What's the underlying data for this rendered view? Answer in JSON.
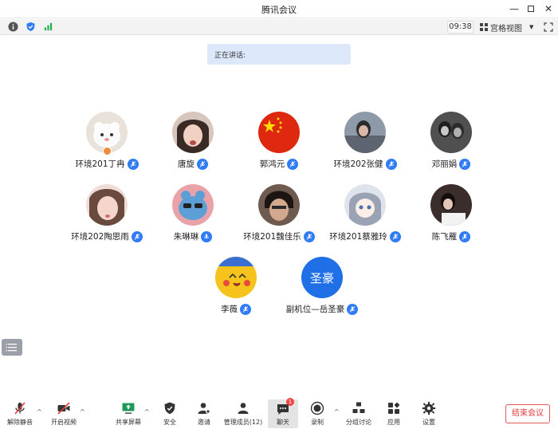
{
  "window": {
    "title": "腾讯会议"
  },
  "infobar": {
    "time": "09:38",
    "view_label": "宫格视图"
  },
  "speaking": {
    "label": "正在讲话:"
  },
  "participants": [
    {
      "name": "环境201丁冉",
      "avatar_color": "#d9d3cc"
    },
    {
      "name": "唐旋",
      "avatar_color": "#c9a99a"
    },
    {
      "name": "郭鸿元",
      "avatar_color": "#de2910"
    },
    {
      "name": "环境202张健",
      "avatar_color": "#7a8797"
    },
    {
      "name": "邓丽娟",
      "avatar_color": "#4a4a4a"
    },
    {
      "name": "环境202陶思雨",
      "avatar_color": "#e8c9c2"
    },
    {
      "name": "朱琳琳",
      "avatar_color": "#5c9fd6"
    },
    {
      "name": "环境201魏佳乐",
      "avatar_color": "#3b2f2a"
    },
    {
      "name": "环境201蔡雅玲",
      "avatar_color": "#b9bfcc"
    },
    {
      "name": "陈飞雁",
      "avatar_color": "#2a2222"
    },
    {
      "name": "李薇",
      "avatar_color": "#f5c31c"
    },
    {
      "name": "副机位—岳圣豪",
      "avatar_text": "圣豪",
      "avatar_color": "#1f6fe6"
    }
  ],
  "toolbar": {
    "unmute": "解除静音",
    "start_video": "开启视频",
    "share_screen": "共享屏幕",
    "security": "安全",
    "invite": "邀请",
    "manage_members": "管理成员(12)",
    "chat": "聊天",
    "chat_badge": "1",
    "record": "录制",
    "breakout": "分组讨论",
    "apps": "应用",
    "settings": "设置",
    "end_meeting": "结束会议"
  },
  "colors": {
    "accent_blue": "#2f7cf6",
    "end_red": "#e33b3b",
    "speaking_bg": "#dde9fb"
  }
}
